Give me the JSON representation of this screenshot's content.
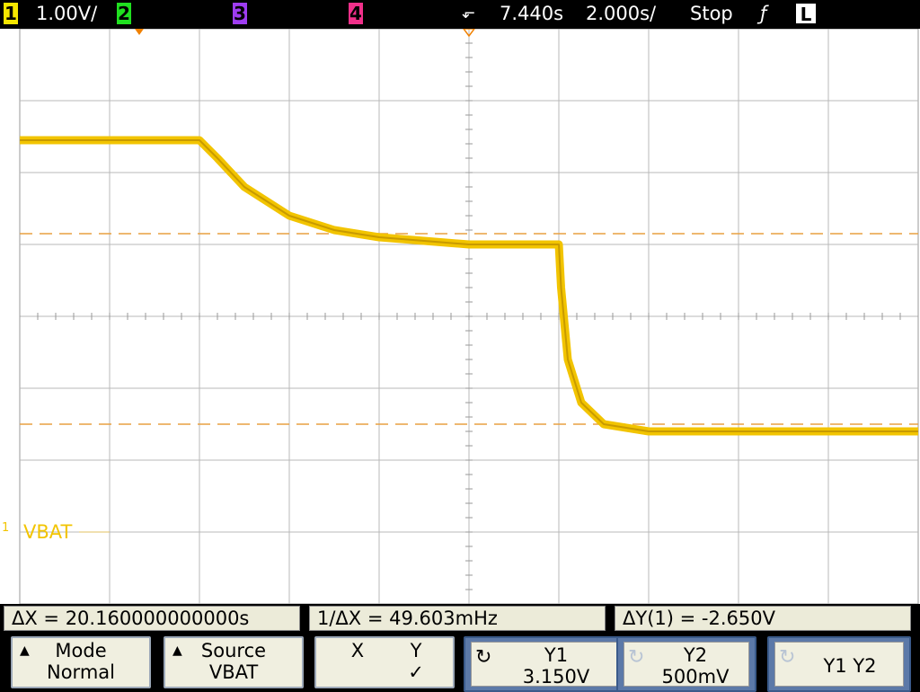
{
  "topbar": {
    "channels": [
      {
        "num": "1",
        "color": "#f6e600",
        "scale": "1.00V/"
      },
      {
        "num": "2",
        "color": "#20e020"
      },
      {
        "num": "3",
        "color": "#9e3cf0"
      },
      {
        "num": "4",
        "color": "#f0308a"
      }
    ],
    "trigger_time": "7.440s",
    "timebase": "2.000s/",
    "run_state": "Stop",
    "trigger_slope": "ƒ",
    "trigger_level_label": "L"
  },
  "display": {
    "channel_label": "VBAT",
    "ground_marker": "1",
    "trace_color": "#f2c400",
    "cursor_color": "#e8a040",
    "trace": [
      {
        "x": -10,
        "y": 2.45
      },
      {
        "x": -6,
        "y": 2.45
      },
      {
        "x": -5.6,
        "y": 2.2
      },
      {
        "x": -5,
        "y": 1.8
      },
      {
        "x": -4,
        "y": 1.4
      },
      {
        "x": -3,
        "y": 1.2
      },
      {
        "x": -2,
        "y": 1.1
      },
      {
        "x": -1,
        "y": 1.05
      },
      {
        "x": 0,
        "y": 1.0
      },
      {
        "x": 2,
        "y": 1.0
      },
      {
        "x": 2.05,
        "y": 0.4
      },
      {
        "x": 2.2,
        "y": -0.6
      },
      {
        "x": 2.5,
        "y": -1.2
      },
      {
        "x": 3,
        "y": -1.5
      },
      {
        "x": 4,
        "y": -1.6
      },
      {
        "x": 10,
        "y": -1.6
      }
    ],
    "cursors_y": [
      1.15,
      -1.5
    ]
  },
  "measurements": {
    "delta_x": "ΔX = 20.160000000000s",
    "inv_delta_x": "1/ΔX = 49.603mHz",
    "delta_y": "ΔY(1) = -2.650V"
  },
  "softkeys": {
    "mode": {
      "label": "Mode",
      "value": "Normal"
    },
    "source": {
      "label": "Source",
      "value": "VBAT"
    },
    "xy": {
      "x": "X",
      "y": "Y",
      "check": "✓"
    },
    "y1": {
      "label": "Y1",
      "value": "3.150V"
    },
    "y2": {
      "label": "Y2",
      "value": "500mV"
    },
    "y1y2": {
      "label": "Y1 Y2"
    }
  }
}
